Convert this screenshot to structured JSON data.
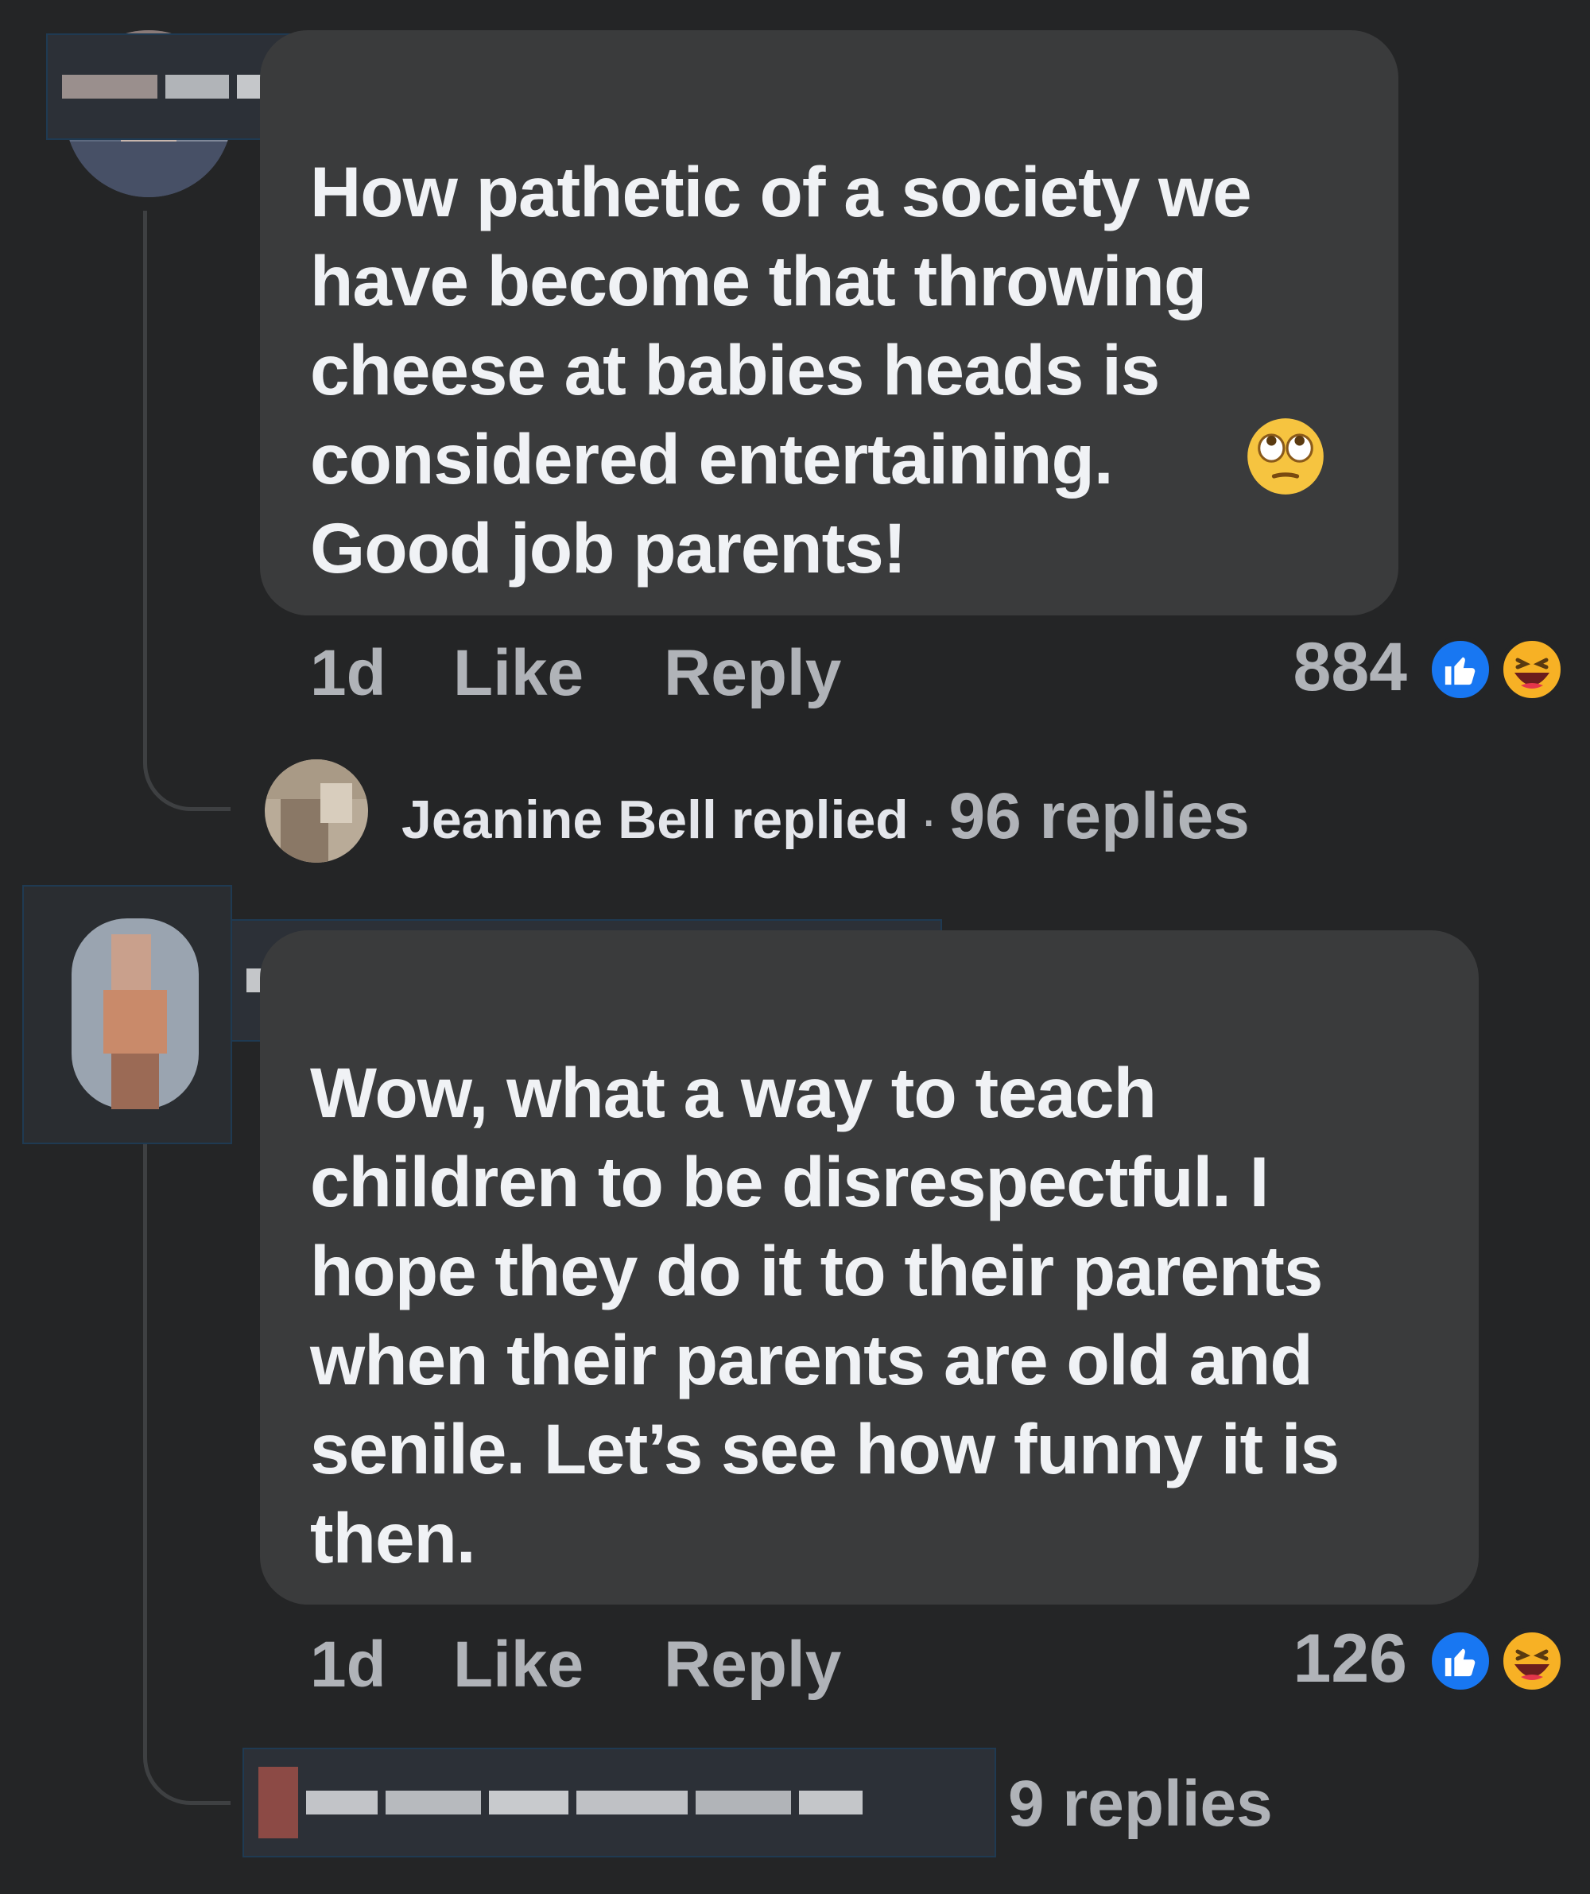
{
  "comments": [
    {
      "author": "",
      "text_lines": [
        "How pathetic of a society we",
        "have become that throwing",
        "cheese at babies heads is",
        "considered entertaining.",
        "Good job parents!"
      ],
      "emoji": "face-with-rolling-eyes",
      "time": "1d",
      "like_label": "Like",
      "reply_label": "Reply",
      "reaction_count": "884",
      "reactions": [
        "like",
        "haha"
      ],
      "reply_preview": {
        "name": "Jeanine Bell",
        "verb": "replied",
        "separator": "·",
        "count": "96 replies"
      }
    },
    {
      "author": "",
      "text_lines": [
        "Wow, what a way to teach",
        "children to be disrespectful. I",
        "hope they do it to their parents",
        "when their parents are old and",
        "senile. Let’s see how funny it is",
        "then."
      ],
      "time": "1d",
      "like_label": "Like",
      "reply_label": "Reply",
      "reaction_count": "126",
      "reactions": [
        "like",
        "haha"
      ],
      "reply_preview": {
        "count": "9 replies"
      }
    }
  ],
  "colors": {
    "background": "#242526",
    "bubble": "#3a3b3c",
    "text": "#f0f2f5",
    "secondary": "#b0b3b8",
    "like_blue": "#1877f2",
    "haha_yellow": "#f7b125"
  }
}
